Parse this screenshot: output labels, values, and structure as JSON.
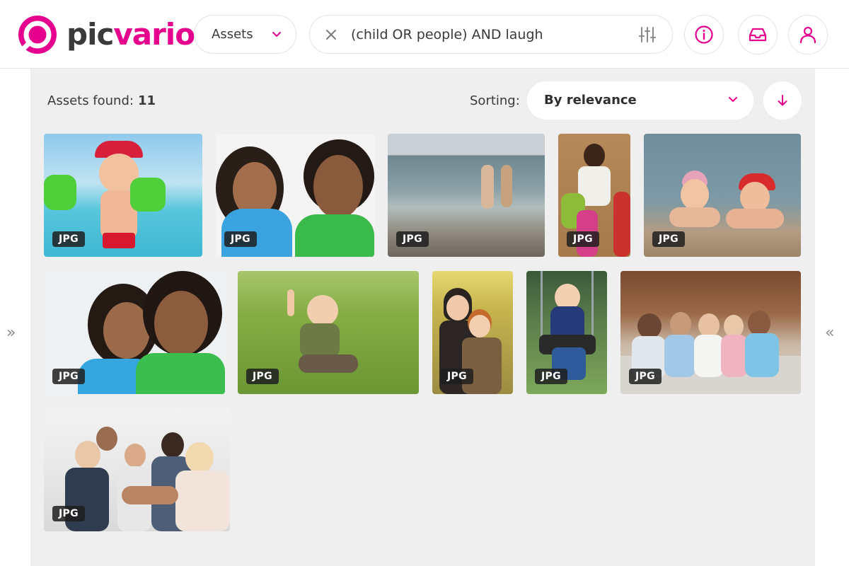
{
  "brand": {
    "name_part1": "pic",
    "name_part2": "vario",
    "accent": "#e6008e"
  },
  "header": {
    "scope_select": {
      "value": "Assets"
    },
    "search": {
      "value": "(child OR people) AND laugh",
      "placeholder": ""
    },
    "icons": [
      "clear-icon",
      "filters-icon",
      "info-icon",
      "inbox-icon",
      "user-icon"
    ]
  },
  "results": {
    "found_label": "Assets found:",
    "found_count": "11",
    "sorting_label": "Sorting:",
    "sorting_value": "By relevance"
  },
  "assets": [
    {
      "type": "JPG"
    },
    {
      "type": "JPG"
    },
    {
      "type": "JPG"
    },
    {
      "type": "JPG"
    },
    {
      "type": "JPG"
    },
    {
      "type": "JPG"
    },
    {
      "type": "JPG"
    },
    {
      "type": "JPG"
    },
    {
      "type": "JPG"
    },
    {
      "type": "JPG"
    },
    {
      "type": "JPG"
    }
  ],
  "nav": {
    "left_arrow": "»",
    "right_arrow": "«"
  }
}
